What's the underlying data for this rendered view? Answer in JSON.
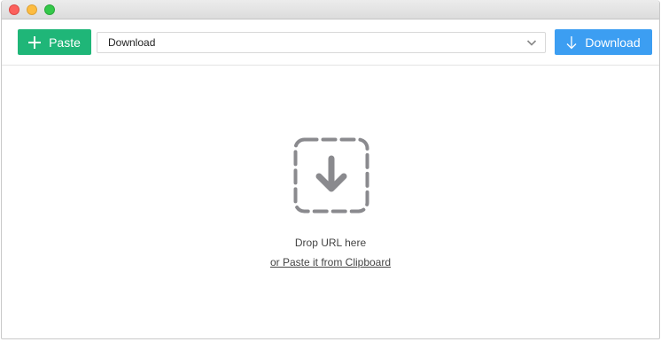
{
  "window": {
    "controls": [
      "close",
      "minimize",
      "zoom"
    ]
  },
  "toolbar": {
    "paste_label": "Paste",
    "paste_icon": "plus-icon",
    "format_value": "Download",
    "format_icon": "chevron-down-icon",
    "download_label": "Download",
    "download_icon": "arrow-down-icon"
  },
  "dropzone": {
    "icon": "download-drop-icon",
    "drop_text": "Drop URL here",
    "paste_link": "or Paste it from Clipboard"
  },
  "colors": {
    "paste_button": "#1fb678",
    "download_button": "#3c9ef2",
    "drop_icon": "#8a8a8e"
  }
}
